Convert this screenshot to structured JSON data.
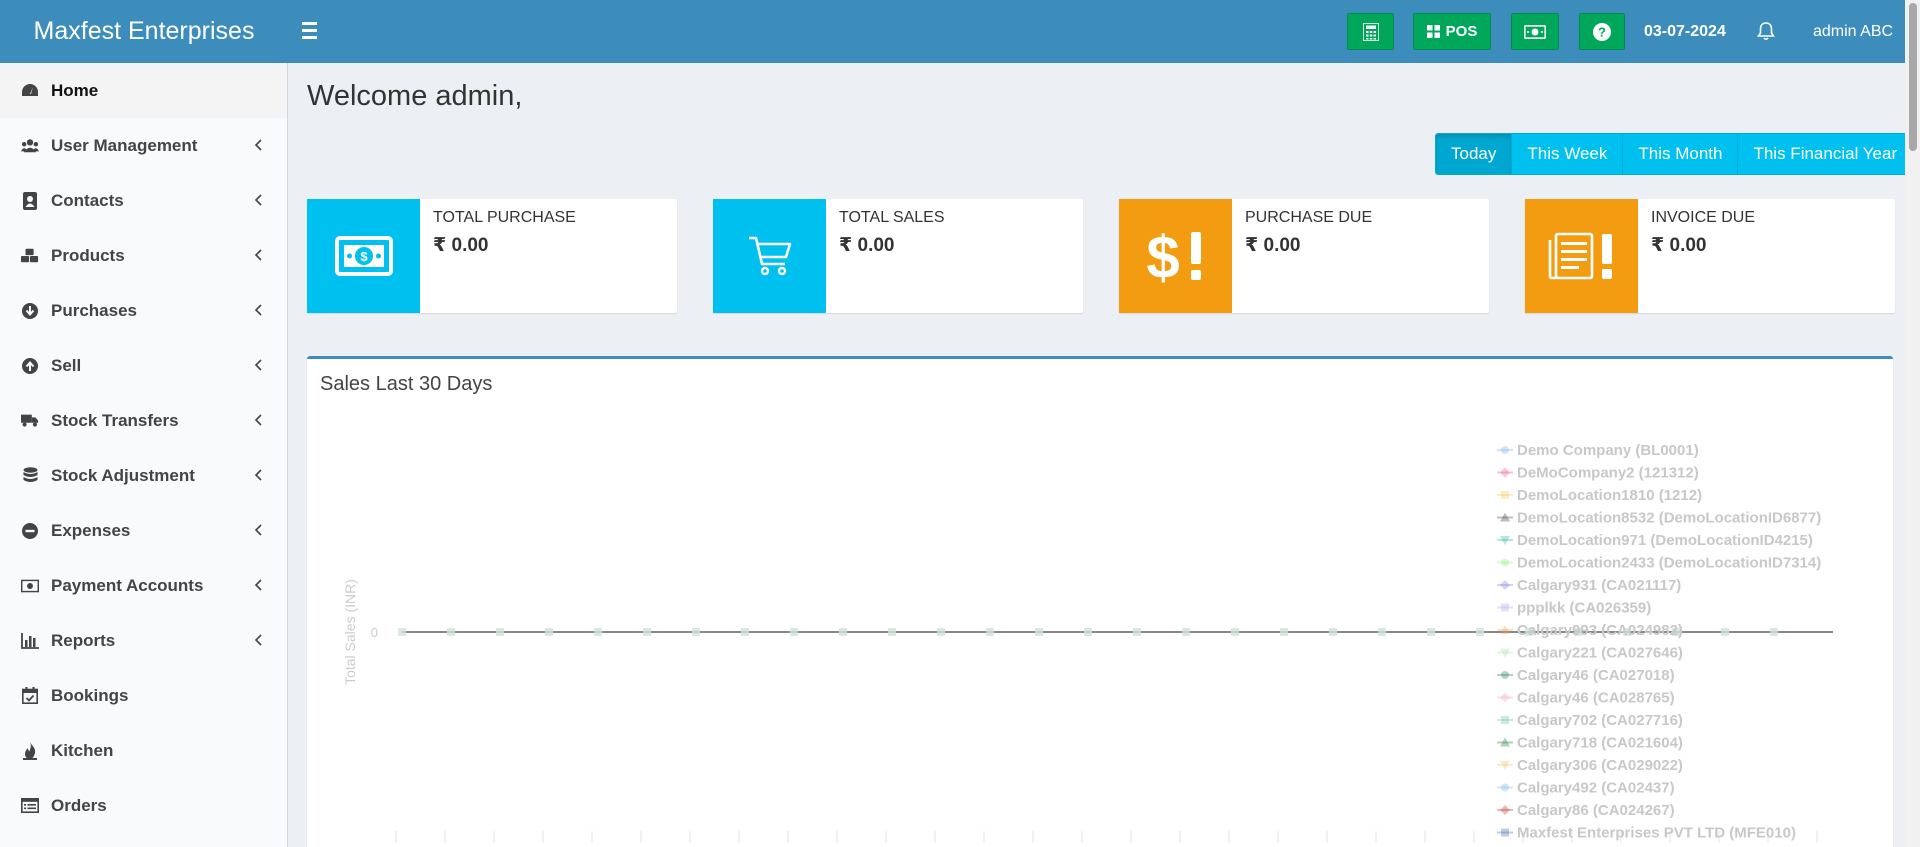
{
  "header": {
    "brand": "Maxfest Enterprises",
    "pos_label": "POS",
    "date": "03-07-2024",
    "user": "admin ABC",
    "accent_color": "#3c8dbc",
    "button_color": "#00a65a",
    "icons": [
      "calculator-icon",
      "pos-icon",
      "cash-icon",
      "help-icon",
      "bell-icon"
    ]
  },
  "sidebar": {
    "items": [
      {
        "label": "Home",
        "icon": "dashboard-icon",
        "active": true
      },
      {
        "label": "User Management",
        "icon": "users-icon"
      },
      {
        "label": "Contacts",
        "icon": "contacts-icon"
      },
      {
        "label": "Products",
        "icon": "cubes-icon"
      },
      {
        "label": "Purchases",
        "icon": "arrow-down-circle-icon"
      },
      {
        "label": "Sell",
        "icon": "arrow-up-circle-icon"
      },
      {
        "label": "Stock Transfers",
        "icon": "truck-icon"
      },
      {
        "label": "Stock Adjustment",
        "icon": "database-icon"
      },
      {
        "label": "Expenses",
        "icon": "minus-circle-icon"
      },
      {
        "label": "Payment Accounts",
        "icon": "money-icon"
      },
      {
        "label": "Reports",
        "icon": "bar-chart-icon"
      },
      {
        "label": "Bookings",
        "icon": "calendar-check-icon"
      },
      {
        "label": "Kitchen",
        "icon": "fire-icon"
      },
      {
        "label": "Orders",
        "icon": "list-icon"
      }
    ]
  },
  "main": {
    "welcome": "Welcome admin,",
    "date_filters": [
      "Today",
      "This Week",
      "This Month",
      "This Financial Year"
    ],
    "active_filter": "Today",
    "stats": [
      {
        "title": "TOTAL PURCHASE",
        "value": "₹ 0.00",
        "icon": "money-bill-icon",
        "color": "#00c0ef"
      },
      {
        "title": "TOTAL SALES",
        "value": "₹ 0.00",
        "icon": "cart-icon",
        "color": "#00c0ef"
      },
      {
        "title": "PURCHASE DUE",
        "value": "₹ 0.00",
        "icon": "dollar-exclamation-icon",
        "color": "#f39c12"
      },
      {
        "title": "INVOICE DUE",
        "value": "₹ 0.00",
        "icon": "invoice-exclamation-icon",
        "color": "#f39c12"
      }
    ]
  },
  "chart_data": {
    "type": "line",
    "title": "Sales Last 30 Days",
    "ylabel": "Total Sales (INR)",
    "y_ticks": [
      "0"
    ],
    "point_count": 29,
    "series": [
      {
        "name": "Demo Company (BL0001)",
        "values": [
          0
        ],
        "color": "#7cb5ec",
        "marker": "circle"
      },
      {
        "name": "DeMoCompany2 (121312)",
        "values": [
          0
        ],
        "color": "#f15c80",
        "marker": "diamond"
      },
      {
        "name": "DemoLocation1810 (1212)",
        "values": [
          0
        ],
        "color": "#f7c862",
        "marker": "square"
      },
      {
        "name": "DemoLocation8532 (DemoLocationID6877)",
        "values": [
          0
        ],
        "color": "#434348",
        "marker": "triangle"
      },
      {
        "name": "DemoLocation971 (DemoLocationID4215)",
        "values": [
          0
        ],
        "color": "#2bb6a7",
        "marker": "triangle-down"
      },
      {
        "name": "DemoLocation2433 (DemoLocationID7314)",
        "values": [
          0
        ],
        "color": "#90ed7d",
        "marker": "circle"
      },
      {
        "name": "Calgary931 (CA021117)",
        "values": [
          0
        ],
        "color": "#8085e9",
        "marker": "diamond"
      },
      {
        "name": "ppplkk (CA026359)",
        "values": [
          0
        ],
        "color": "#b8a9f0",
        "marker": "square"
      },
      {
        "name": "Calgary993 (CA024982)",
        "values": [
          0
        ],
        "color": "#f7a35c",
        "marker": "triangle"
      },
      {
        "name": "Calgary221 (CA027646)",
        "values": [
          0
        ],
        "color": "#a5e3a0",
        "marker": "triangle-down"
      },
      {
        "name": "Calgary46 (CA027018)",
        "values": [
          0
        ],
        "color": "#2f7e5e",
        "marker": "circle"
      },
      {
        "name": "Calgary46 (CA028765)",
        "values": [
          0
        ],
        "color": "#f4a7b9",
        "marker": "diamond"
      },
      {
        "name": "Calgary702 (CA027716)",
        "values": [
          0
        ],
        "color": "#6cc3b0",
        "marker": "square"
      },
      {
        "name": "Calgary718 (CA021604)",
        "values": [
          0
        ],
        "color": "#1f7a3d",
        "marker": "triangle"
      },
      {
        "name": "Calgary306 (CA029022)",
        "values": [
          0
        ],
        "color": "#f9c46b",
        "marker": "triangle-down"
      },
      {
        "name": "Calgary492 (CA02437)",
        "values": [
          0
        ],
        "color": "#7cb5ec",
        "marker": "circle"
      },
      {
        "name": "Calgary86 (CA024267)",
        "values": [
          0
        ],
        "color": "#c0392b",
        "marker": "diamond"
      },
      {
        "name": "Maxfest Enterprises PVT LTD (MFE010)",
        "values": [
          0
        ],
        "color": "#4a6fb5",
        "marker": "square"
      }
    ]
  }
}
